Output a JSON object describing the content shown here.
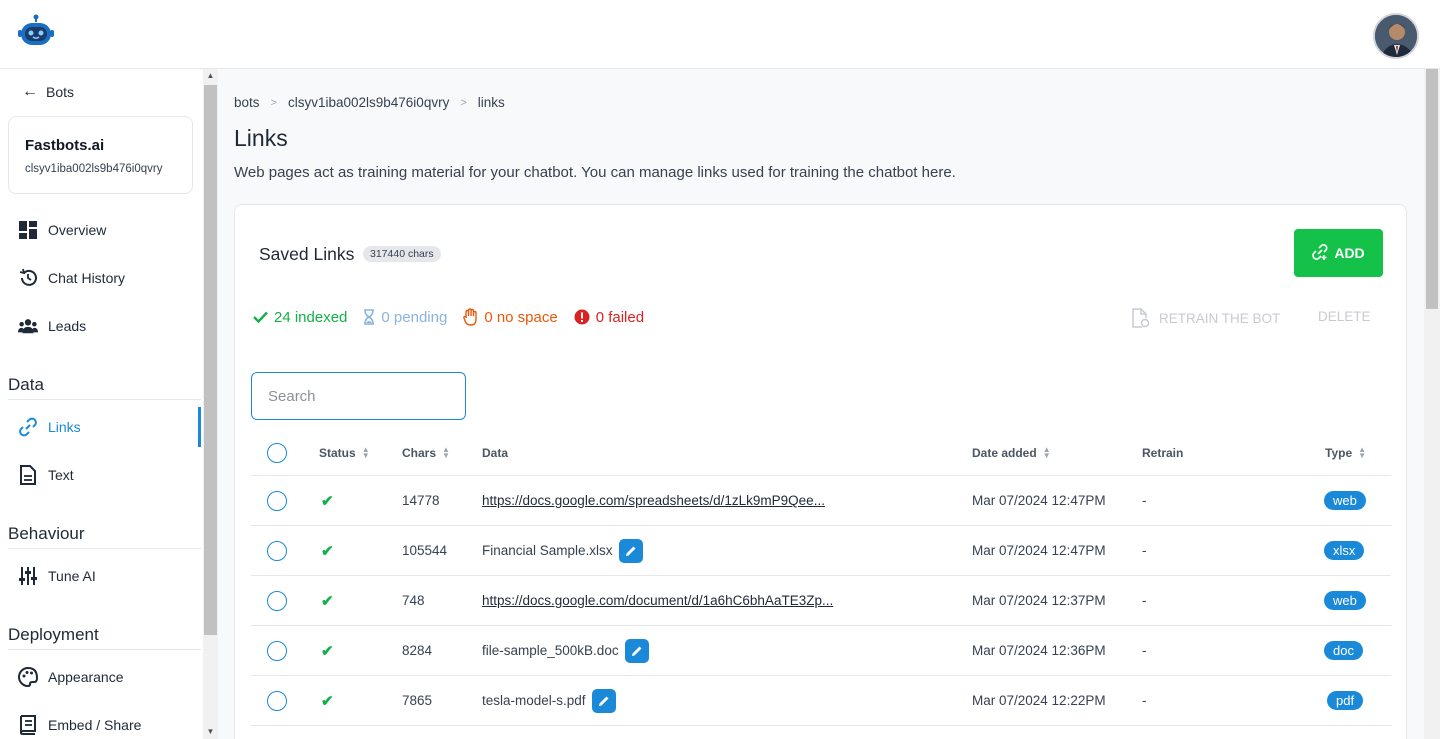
{
  "app": {
    "logo_icon": "robot-logo-icon",
    "avatar_icon": "user-avatar"
  },
  "sidebar": {
    "back_label": "Bots",
    "bot": {
      "name": "Fastbots.ai",
      "id": "clsyv1iba002ls9b476i0qvry"
    },
    "items": [
      {
        "label": "Overview",
        "icon": "dashboard-icon"
      },
      {
        "label": "Chat History",
        "icon": "history-icon"
      },
      {
        "label": "Leads",
        "icon": "users-icon"
      }
    ],
    "sections": [
      {
        "title": "Data",
        "items": [
          {
            "label": "Links",
            "icon": "link-icon",
            "active": true
          },
          {
            "label": "Text",
            "icon": "document-icon"
          }
        ]
      },
      {
        "title": "Behaviour",
        "items": [
          {
            "label": "Tune AI",
            "icon": "sliders-icon"
          }
        ]
      },
      {
        "title": "Deployment",
        "items": [
          {
            "label": "Appearance",
            "icon": "palette-icon"
          },
          {
            "label": "Embed / Share",
            "icon": "book-icon"
          }
        ]
      }
    ]
  },
  "breadcrumb": [
    "bots",
    "clsyv1iba002ls9b476i0qvry",
    "links"
  ],
  "page": {
    "title": "Links",
    "description": "Web pages act as training material for your chatbot. You can manage links used for training the chatbot here."
  },
  "card": {
    "title": "Saved Links",
    "chars_badge": "317440 chars",
    "add_label": "ADD",
    "stats": {
      "indexed": "24 indexed",
      "pending": "0 pending",
      "no_space": "0 no space",
      "failed": "0 failed"
    },
    "colors": {
      "indexed": "#14b04a",
      "pending": "#8ab4e0",
      "no_space": "#e8590c",
      "failed": "#d92323",
      "accent": "#1a8ad8",
      "add": "#14c24a"
    },
    "retrain_label": "RETRAIN THE BOT",
    "delete_label": "DELETE",
    "search_placeholder": "Search"
  },
  "table": {
    "headers": {
      "status": "Status",
      "chars": "Chars",
      "data": "Data",
      "date": "Date added",
      "retrain": "Retrain",
      "type": "Type"
    },
    "rows": [
      {
        "chars": "14778",
        "data": "https://docs.google.com/spreadsheets/d/1zLk9mP9Qee...",
        "is_link": true,
        "date": "Mar 07/2024 12:47PM",
        "retrain": "-",
        "type": "web"
      },
      {
        "chars": "105544",
        "data": "Financial Sample.xlsx",
        "is_link": false,
        "date": "Mar 07/2024 12:47PM",
        "retrain": "-",
        "type": "xlsx"
      },
      {
        "chars": "748",
        "data": "https://docs.google.com/document/d/1a6hC6bhAaTE3Zp...",
        "is_link": true,
        "date": "Mar 07/2024 12:37PM",
        "retrain": "-",
        "type": "web"
      },
      {
        "chars": "8284",
        "data": "file-sample_500kB.doc",
        "is_link": false,
        "date": "Mar 07/2024 12:36PM",
        "retrain": "-",
        "type": "doc"
      },
      {
        "chars": "7865",
        "data": "tesla-model-s.pdf",
        "is_link": false,
        "date": "Mar 07/2024 12:22PM",
        "retrain": "-",
        "type": "pdf"
      }
    ]
  }
}
